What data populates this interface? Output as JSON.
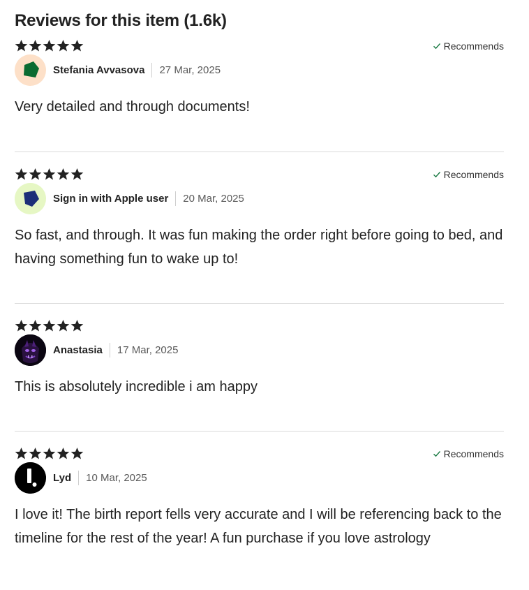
{
  "reviews_section": {
    "title": "Reviews for this item (1.6k)",
    "star_icon": "star-icon",
    "star_color": "#222222",
    "recommends_label": "Recommends",
    "recommends_check_color": "#1a7a43",
    "reviews": [
      {
        "rating": 5,
        "recommends": true,
        "reviewer": "Stefania Avvasova",
        "date": "27 Mar, 2025",
        "avatar": {
          "icon": "green-pentagon-avatar",
          "bg": "#fde0c8",
          "shape_color": "#0a6b31"
        },
        "text": "Very detailed and through documents!"
      },
      {
        "rating": 5,
        "recommends": true,
        "reviewer": "Sign in with Apple user",
        "date": "20 Mar, 2025",
        "avatar": {
          "icon": "navy-pentagon-avatar",
          "bg": "#e6f7c4",
          "shape_color": "#1c2f78"
        },
        "text": "So fast, and through. It was fun making the order right before going to bed, and having something fun to wake up to!"
      },
      {
        "rating": 5,
        "recommends": false,
        "reviewer": "Anastasia",
        "date": "17 Mar, 2025",
        "avatar": {
          "icon": "photo-avatar",
          "bg": "#0b0612",
          "shape_color": "#6a2ba8"
        },
        "text": "This is absolutely incredible i am happy"
      },
      {
        "rating": 5,
        "recommends": true,
        "reviewer": "Lyd",
        "date": "10 Mar, 2025",
        "avatar": {
          "icon": "letter-logo-avatar",
          "bg": "#000000",
          "shape_color": "#ffffff"
        },
        "text": "I love it! The birth report fells very accurate and I will be referencing back to the timeline for the rest of the year! A fun purchase if you love astrology"
      }
    ]
  }
}
